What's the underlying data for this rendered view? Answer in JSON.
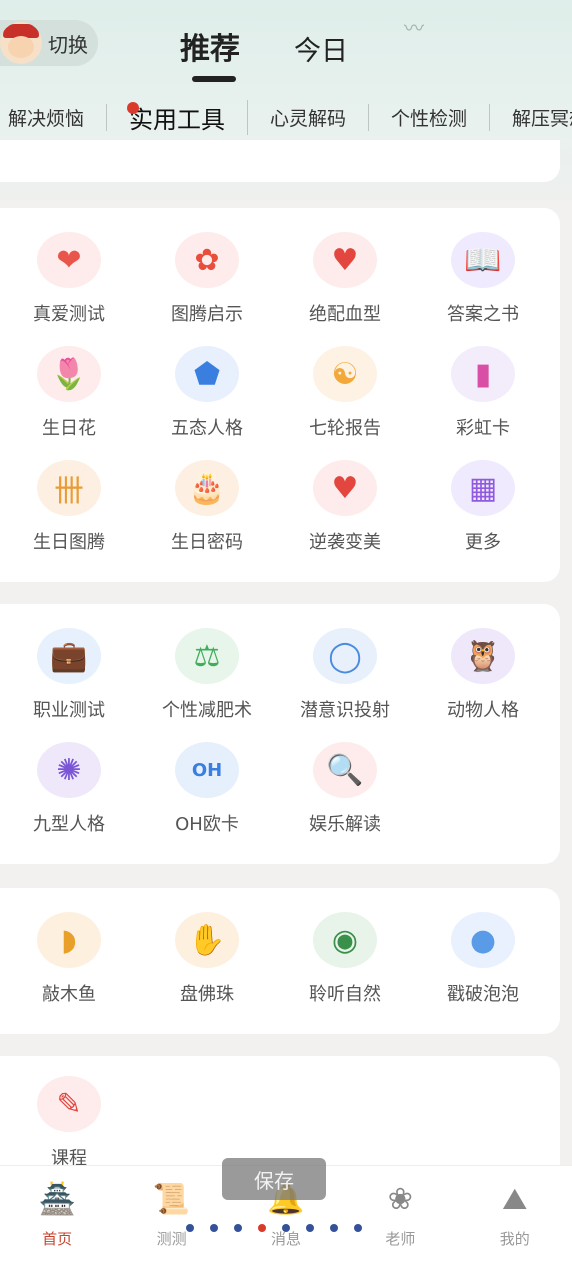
{
  "header": {
    "switch_label": "切换",
    "tabs": [
      {
        "label": "推荐",
        "active": true
      },
      {
        "label": "今日",
        "active": false
      }
    ]
  },
  "categories": [
    {
      "label": "解决烦恼",
      "active": false
    },
    {
      "label": "实用工具",
      "active": true
    },
    {
      "label": "心灵解码",
      "active": false
    },
    {
      "label": "个性检测",
      "active": false
    },
    {
      "label": "解压冥想",
      "active": false
    }
  ],
  "section1": {
    "items": [
      {
        "label": "真爱测试",
        "icon": "heart-icon",
        "glyph": "❤",
        "color": "#e9554b",
        "bg": "#fdeceb"
      },
      {
        "label": "图腾启示",
        "icon": "flower-icon",
        "glyph": "✿",
        "color": "#e94e3d",
        "bg": "#fdeceb"
      },
      {
        "label": "绝配血型",
        "icon": "blood-drop-icon",
        "glyph": "♥",
        "color": "#e2463e",
        "bg": "#fdeceb"
      },
      {
        "label": "答案之书",
        "icon": "magic-book-icon",
        "glyph": "📖",
        "color": "#7a4ed8",
        "bg": "#efeafd"
      },
      {
        "label": "生日花",
        "icon": "tulip-icon",
        "glyph": "🌷",
        "color": "#e24a3e",
        "bg": "#fdeceb"
      },
      {
        "label": "五态人格",
        "icon": "pentagon-network-icon",
        "glyph": "⬟",
        "color": "#3a7fe0",
        "bg": "#e8f0fd"
      },
      {
        "label": "七轮报告",
        "icon": "meditation-icon",
        "glyph": "☯",
        "color": "#f2a93a",
        "bg": "#fdf2e3"
      },
      {
        "label": "彩虹卡",
        "icon": "rainbow-cards-icon",
        "glyph": "▮",
        "color": "#d94fa6",
        "bg": "#f3ecfb"
      },
      {
        "label": "生日图腾",
        "icon": "totem-icon",
        "glyph": "卌",
        "color": "#e89b36",
        "bg": "#fdf0e2"
      },
      {
        "label": "生日密码",
        "icon": "birthday-cake-icon",
        "glyph": "🎂",
        "color": "#e89b36",
        "bg": "#fdf0e2"
      },
      {
        "label": "逆袭变美",
        "icon": "heartbeat-icon",
        "glyph": "♥",
        "color": "#e2463e",
        "bg": "#fdeceb"
      },
      {
        "label": "更多",
        "icon": "more-grid-icon",
        "glyph": "▦",
        "color": "#8f5ae0",
        "bg": "#efeafd"
      }
    ]
  },
  "section2": {
    "items": [
      {
        "label": "职业测试",
        "icon": "briefcase-icon",
        "glyph": "💼",
        "color": "#3a8fe0",
        "bg": "#e6f1fd"
      },
      {
        "label": "个性减肥术",
        "icon": "scale-icon",
        "glyph": "⚖",
        "color": "#3fae5c",
        "bg": "#e7f5ea"
      },
      {
        "label": "潜意识投射",
        "icon": "mirror-icon",
        "glyph": "◯",
        "color": "#4a8be0",
        "bg": "#e7f0fb"
      },
      {
        "label": "动物人格",
        "icon": "owl-card-icon",
        "glyph": "🦉",
        "color": "#8a4fd6",
        "bg": "#efe8fb"
      },
      {
        "label": "九型人格",
        "icon": "enneagram-icon",
        "glyph": "✺",
        "color": "#7a55d6",
        "bg": "#efe8fb"
      },
      {
        "label": "OH欧卡",
        "icon": "oh-card-icon",
        "glyph": "OH",
        "color": "#3a7fe0",
        "bg": "#e6f0fd"
      },
      {
        "label": "娱乐解读",
        "icon": "book-search-icon",
        "glyph": "🔍",
        "color": "#e2463e",
        "bg": "#fdeceb"
      }
    ]
  },
  "section3": {
    "items": [
      {
        "label": "敲木鱼",
        "icon": "wooden-fish-icon",
        "glyph": "◗",
        "color": "#e8a02a",
        "bg": "#fdf0df"
      },
      {
        "label": "盘佛珠",
        "icon": "prayer-beads-icon",
        "glyph": "✋",
        "color": "#e8a02a",
        "bg": "#fdf0df"
      },
      {
        "label": "聆听自然",
        "icon": "nature-sound-icon",
        "glyph": "◉",
        "color": "#3a8f4a",
        "bg": "#e8f4ea"
      },
      {
        "label": "戳破泡泡",
        "icon": "bubbles-icon",
        "glyph": "●",
        "color": "#5a9be8",
        "bg": "#e8f1fd"
      }
    ]
  },
  "section4": {
    "items": [
      {
        "label": "课程",
        "icon": "course-book-icon",
        "glyph": "✎",
        "color": "#e2463e",
        "bg": "#fdeceb"
      }
    ]
  },
  "save_tip": "保存",
  "pager": {
    "count": 8,
    "current": 3
  },
  "tabbar": [
    {
      "label": "首页",
      "icon": "palace-icon",
      "glyph": "🏯",
      "active": true
    },
    {
      "label": "测测",
      "icon": "scroll-icon",
      "glyph": "📜",
      "active": false
    },
    {
      "label": "消息",
      "icon": "bell-icon",
      "glyph": "🔔",
      "active": false
    },
    {
      "label": "老师",
      "icon": "lotus-icon",
      "glyph": "❀",
      "active": false
    },
    {
      "label": "我的",
      "icon": "straw-hat-icon",
      "glyph": "⛰",
      "active": false
    }
  ]
}
